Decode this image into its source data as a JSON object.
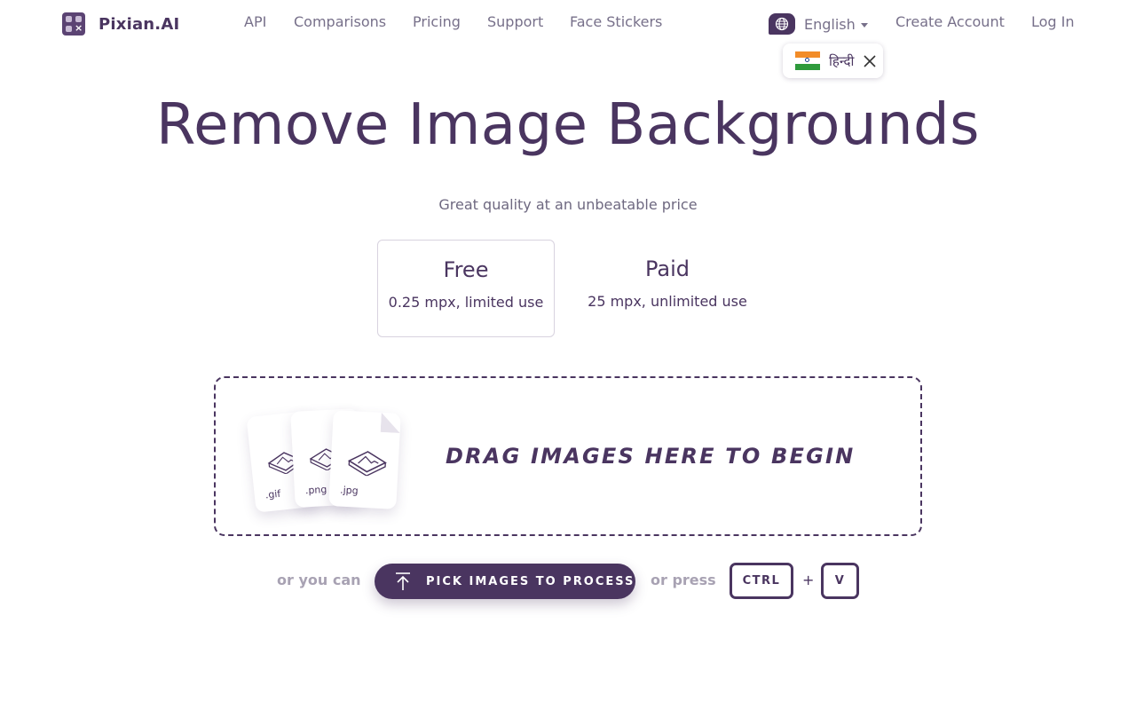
{
  "header": {
    "brand": "Pixian.AI",
    "nav": {
      "api": "API",
      "comparisons": "Comparisons",
      "pricing": "Pricing",
      "support": "Support",
      "face_stickers": "Face Stickers"
    },
    "language": {
      "label": "English",
      "icon": "globe-icon"
    },
    "create_account": "Create Account",
    "log_in": "Log In"
  },
  "language_popup": {
    "option": "हिन्दी",
    "flag": "india-flag-icon",
    "close_icon": "close-icon"
  },
  "hero": {
    "title": "Remove Image Backgrounds",
    "subtitle": "Great quality at an unbeatable price"
  },
  "plans": [
    {
      "name": "Free",
      "description": "0.25 mpx, limited use",
      "selected": true
    },
    {
      "name": "Paid",
      "description": "25 mpx, unlimited use",
      "selected": false
    }
  ],
  "dropzone": {
    "label": "DRAG IMAGES HERE TO BEGIN",
    "file_types": [
      ".gif",
      ".png",
      ".jpg"
    ]
  },
  "actions": {
    "or_you_can": "or you can",
    "pick_button": "PICK IMAGES TO PROCESS",
    "or_press": "or press",
    "key_ctrl": "CTRL",
    "plus": "+",
    "key_v": "V"
  },
  "colors": {
    "brand": "#4a3560",
    "muted": "#77708a",
    "hint": "#a8a2b3"
  }
}
